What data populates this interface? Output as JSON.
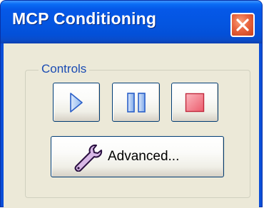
{
  "window": {
    "title": "MCP Conditioning"
  },
  "controls": {
    "group_label": "Controls",
    "advanced_label": "Advanced..."
  },
  "icons": {
    "play": "play-icon",
    "pause": "pause-icon",
    "stop": "stop-icon",
    "advanced": "wrench-icon",
    "close": "close-icon"
  },
  "colors": {
    "titlebar": "#0558e8",
    "client_bg": "#ece9d8",
    "group_label": "#1a4bb3",
    "close_button": "#e8643e",
    "stop_glyph": "#f06d7a",
    "play_pause_glyph": "#9ec3f5"
  }
}
